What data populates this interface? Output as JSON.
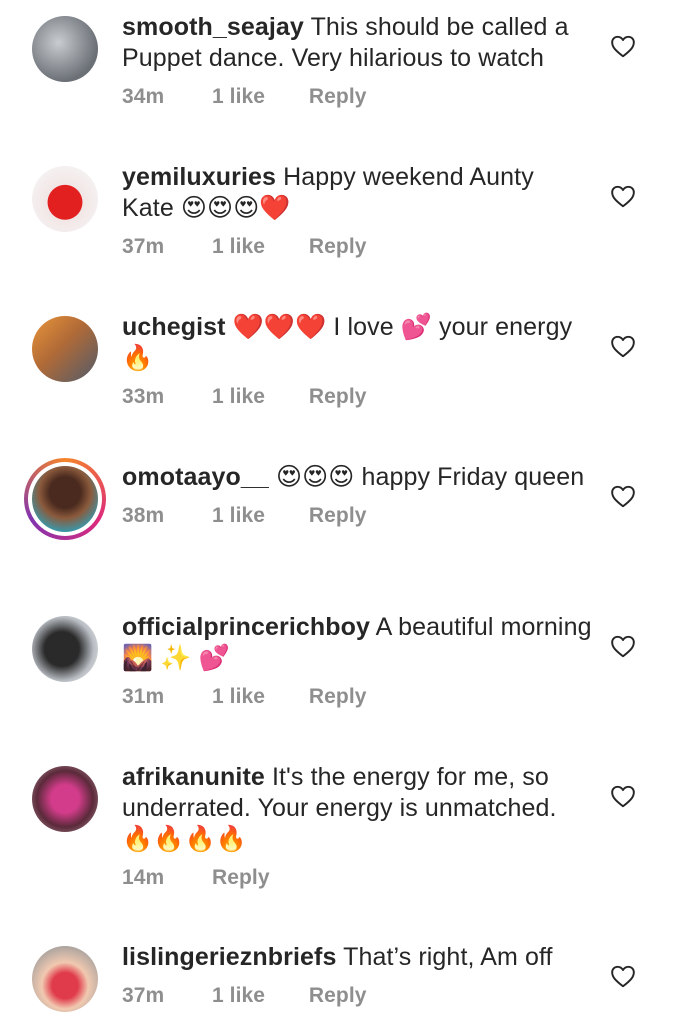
{
  "comments": [
    {
      "username": "smooth_seajay",
      "text": "This should be called a Puppet dance. Very hilarious to watch",
      "time": "34m",
      "likes": "1 like",
      "reply": "Reply",
      "avatar": "avatar-gym-photo"
    },
    {
      "username": "yemiluxuries",
      "text": "Happy weekend Aunty Kate 😍😍😍❤️",
      "time": "37m",
      "likes": "1 like",
      "reply": "Reply",
      "avatar": "avatar-red-bag"
    },
    {
      "username": "uchegist",
      "text": "❤️❤️❤️ I love 💕 your energy 🔥",
      "time": "33m",
      "likes": "1 like",
      "reply": "Reply",
      "avatar": "avatar-couple"
    },
    {
      "username": "omotaayo__",
      "text": "😍😍😍 happy Friday queen",
      "time": "38m",
      "likes": "1 like",
      "reply": "Reply",
      "avatar": "avatar-woman-story",
      "has_story_ring": true
    },
    {
      "username": "officialprincerichboy",
      "text": "A beautiful morning 🌄 ✨ 💕",
      "time": "31m",
      "likes": "1 like",
      "reply": "Reply",
      "avatar": "avatar-man-cap"
    },
    {
      "username": "afrikanunite",
      "text": "It's the energy for me, so underrated. Your energy is unmatched. 🔥🔥🔥🔥",
      "time": "14m",
      "likes": "",
      "reply": "Reply",
      "avatar": "avatar-face-paint"
    },
    {
      "username": "lislingerieznbriefs",
      "text": "That’s right, Am off",
      "time": "37m",
      "likes": "1 like",
      "reply": "Reply",
      "avatar": "avatar-lingerie"
    }
  ],
  "icons": {
    "like": "heart-outline-icon"
  },
  "colors": {
    "text": "#262626",
    "meta": "#8e8e8e",
    "background": "#ffffff"
  }
}
